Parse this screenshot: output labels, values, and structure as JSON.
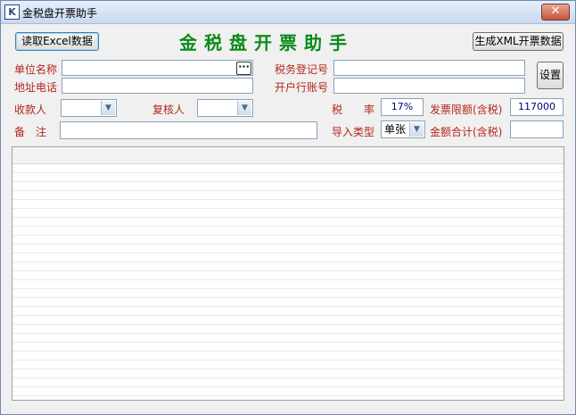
{
  "window": {
    "title": "金税盘开票助手",
    "icon_letter": "K",
    "close_glyph": "✕"
  },
  "toolbar": {
    "read_excel_label": "读取Excel数据",
    "app_heading": "金税盘开票助手",
    "generate_xml_label": "生成XML开票数据",
    "settings_label": "设置",
    "ellipsis_label": "···"
  },
  "form": {
    "company_name_label": "单位名称",
    "address_phone_label": "地址电话",
    "tax_reg_label": "税务登记号",
    "bank_account_label": "开户行账号",
    "payee_label": "收款人",
    "reviewer_label": "复核人",
    "tax_rate_label": "税　　率",
    "tax_rate_value": "17%",
    "invoice_limit_label": "发票限额(含税)",
    "invoice_limit_value": "117000",
    "remarks_label": "备　注",
    "import_type_label": "导入类型",
    "import_type_value": "单张",
    "total_amount_label": "金额合计(含税)",
    "total_amount_value": ""
  },
  "colors": {
    "heading": "#0b8a1a",
    "label_red": "#b3261e"
  }
}
